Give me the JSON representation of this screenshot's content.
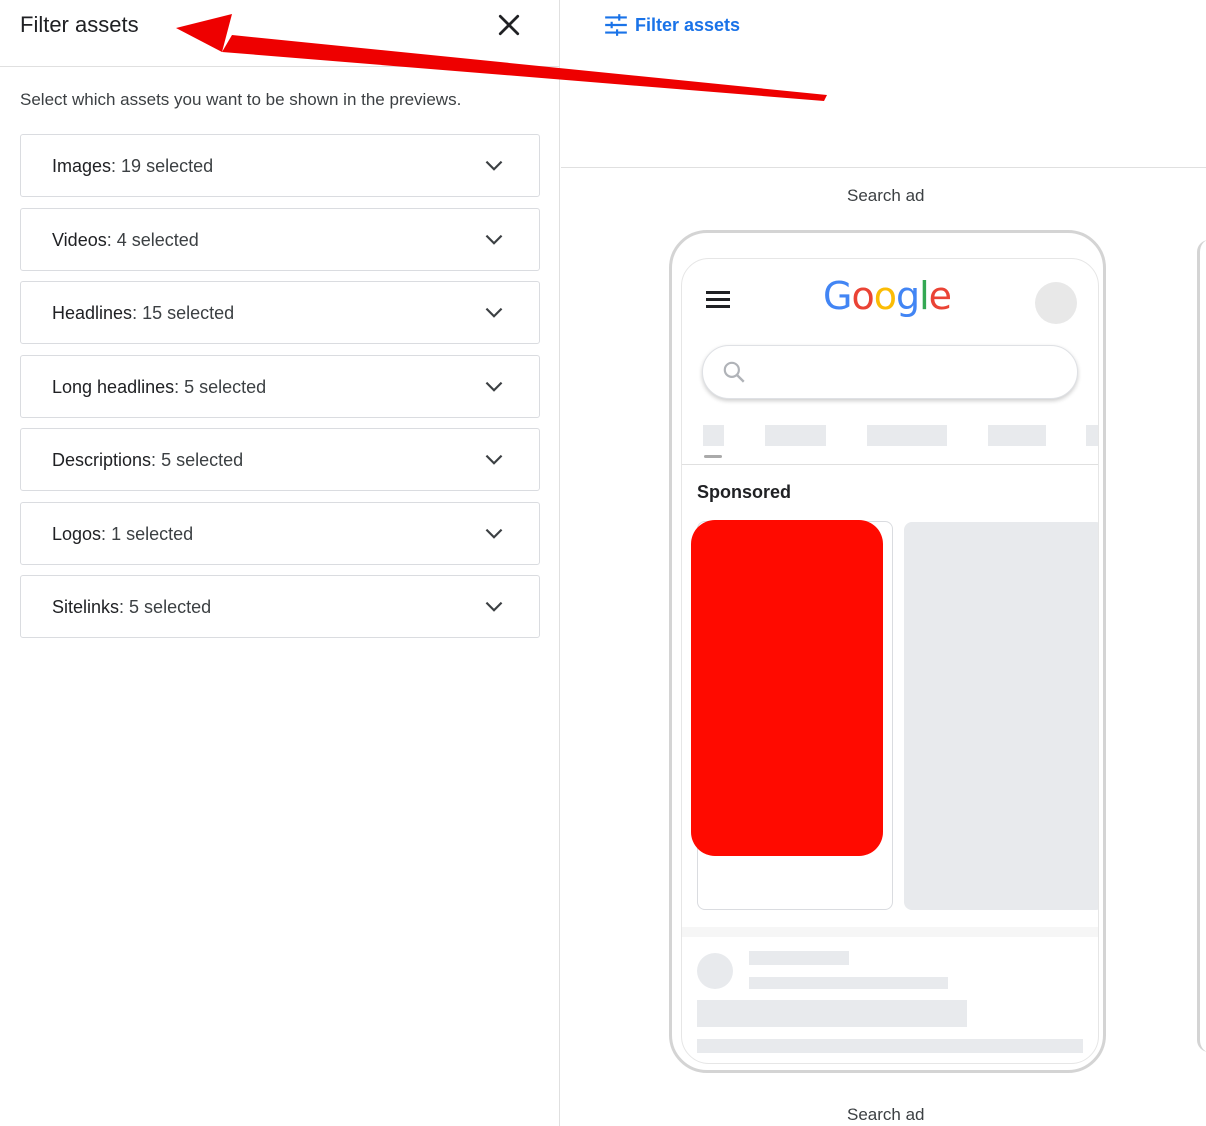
{
  "panel": {
    "title": "Filter assets",
    "description": "Select which assets you want to be shown in the previews.",
    "filters": [
      {
        "name": "Images",
        "value": "19 selected"
      },
      {
        "name": "Videos",
        "value": "4 selected"
      },
      {
        "name": "Headlines",
        "value": "15 selected"
      },
      {
        "name": "Long headlines",
        "value": "5 selected"
      },
      {
        "name": "Descriptions",
        "value": "5 selected"
      },
      {
        "name": "Logos",
        "value": "1 selected"
      },
      {
        "name": "Sitelinks",
        "value": "5 selected"
      }
    ],
    "icons": {
      "close": "close-icon",
      "expand": "chevron-down-icon"
    }
  },
  "preview": {
    "filter_button_label": "Filter assets",
    "caption_top": "Search ad",
    "caption_bottom": "Search ad",
    "phone": {
      "logo_text": "Google",
      "sponsored_label": "Sponsored"
    }
  },
  "colors": {
    "accent": "#1a73e8",
    "annotation": "#ee0000",
    "redaction": "#ff0a00",
    "google_blue": "#4285F4",
    "google_red": "#EA4335",
    "google_yellow": "#FBBC05",
    "google_green": "#34A853"
  }
}
